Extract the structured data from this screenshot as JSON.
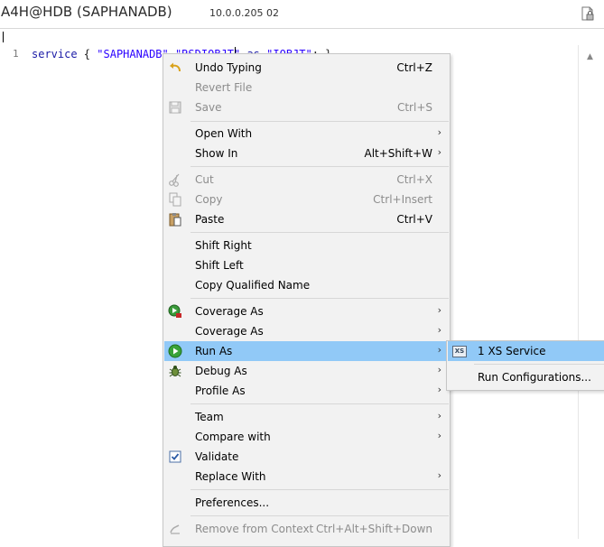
{
  "title": {
    "connection": "A4H@HDB (SAPHANADB)",
    "host": "10.0.0.205 02"
  },
  "editor": {
    "line_number": "1",
    "code": {
      "kw": "service",
      "brace": " { ",
      "s1": "\"SAPHANADB\"",
      "dot": ".",
      "s2": "\"RSDIOBJT\"",
      "as": " as ",
      "s3": "\"IOBJT\"",
      "end": "; }"
    }
  },
  "menu": {
    "undo_typing": {
      "label": "Undo Typing",
      "shortcut": "Ctrl+Z"
    },
    "revert_file": {
      "label": "Revert File"
    },
    "save": {
      "label": "Save",
      "shortcut": "Ctrl+S"
    },
    "open_with": {
      "label": "Open With"
    },
    "show_in": {
      "label": "Show In",
      "shortcut": "Alt+Shift+W"
    },
    "cut": {
      "label": "Cut",
      "shortcut": "Ctrl+X"
    },
    "copy": {
      "label": "Copy",
      "shortcut": "Ctrl+Insert"
    },
    "paste": {
      "label": "Paste",
      "shortcut": "Ctrl+V"
    },
    "shift_right": {
      "label": "Shift Right"
    },
    "shift_left": {
      "label": "Shift Left"
    },
    "copy_qualified_name": {
      "label": "Copy Qualified Name"
    },
    "coverage_as_1": {
      "label": "Coverage As"
    },
    "coverage_as_2": {
      "label": "Coverage As"
    },
    "run_as": {
      "label": "Run As"
    },
    "debug_as": {
      "label": "Debug As"
    },
    "profile_as": {
      "label": "Profile As"
    },
    "team": {
      "label": "Team"
    },
    "compare_with": {
      "label": "Compare with"
    },
    "validate": {
      "label": "Validate"
    },
    "replace_with": {
      "label": "Replace With"
    },
    "preferences": {
      "label": "Preferences..."
    },
    "remove_from_context": {
      "label": "Remove from Context",
      "shortcut": "Ctrl+Alt+Shift+Down"
    }
  },
  "submenu": {
    "xs_service": {
      "label": "1 XS Service",
      "icon_text": "XS"
    },
    "run_configurations": {
      "label": "Run Configurations..."
    }
  },
  "colors": {
    "highlight": "#91c9f7",
    "menu_bg": "#f2f2f2",
    "disabled_text": "#8c8c8c"
  },
  "icons": {
    "undo": "undo-arrow-icon",
    "save": "disk-icon",
    "cut": "scissors-icon",
    "copy": "copy-icon",
    "paste": "clipboard-icon",
    "coverage": "coverage-icon",
    "run": "run-green-icon",
    "debug": "bug-icon",
    "validate": "checkbox-icon",
    "remove_context": "remove-context-icon"
  }
}
